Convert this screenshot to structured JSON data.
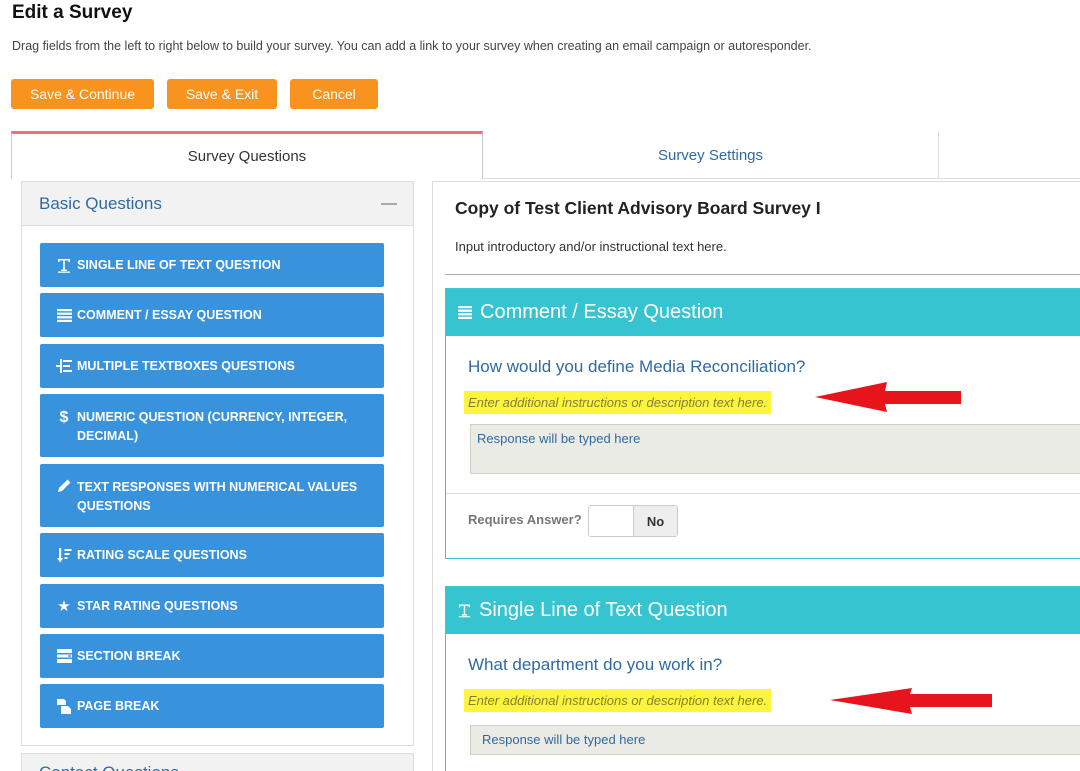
{
  "page": {
    "title": "Edit a Survey",
    "description": "Drag fields from the left to right below to build your survey. You can add a link to your survey when creating an email campaign or autoresponder."
  },
  "buttons": {
    "save_continue": "Save & Continue",
    "save_exit": "Save & Exit",
    "cancel": "Cancel"
  },
  "tabs": [
    {
      "label": "Survey Questions",
      "active": true
    },
    {
      "label": "Survey Settings",
      "active": false
    }
  ],
  "sidebar": {
    "section_title": "Basic Questions",
    "items": [
      {
        "label": "Single Line of Text Question",
        "icon": "text-icon"
      },
      {
        "label": "Comment / Essay Question",
        "icon": "lines-icon"
      },
      {
        "label": "Multiple Textboxes Questions",
        "icon": "textboxes-icon"
      },
      {
        "label": "Numeric Question (Currency, Integer, Decimal)",
        "icon": "dollar-icon"
      },
      {
        "label": "Text Responses with Numerical Values Questions",
        "icon": "pencil-icon"
      },
      {
        "label": "Rating Scale Questions",
        "icon": "sort-icon"
      },
      {
        "label": "Star Rating Questions",
        "icon": "star-icon"
      },
      {
        "label": "Section Break",
        "icon": "section-icon"
      },
      {
        "label": "Page Break",
        "icon": "page-break-icon"
      }
    ],
    "next_section_title": "Contact Questions"
  },
  "survey": {
    "title": "Copy of Test Client Advisory Board Survey I",
    "intro": "Input introductory and/or instructional text here.",
    "cards": [
      {
        "type_label": "Comment / Essay Question",
        "question": "How would you define Media Reconciliation?",
        "instructions": "Enter additional instructions or description text here.",
        "response_placeholder": "Response will be typed here",
        "requires_label": "Requires Answer?",
        "requires_value": "No"
      },
      {
        "type_label": "Single Line of Text Question",
        "question": "What department do you work in?",
        "instructions": "Enter additional instructions or description text here.",
        "response_placeholder": "Response will be typed here"
      }
    ]
  },
  "colors": {
    "accent_orange": "#f7931e",
    "question_blue": "#3893dc",
    "card_teal": "#36c5d0",
    "highlight_yellow": "#fbf53b",
    "annotation_red": "#e8141b"
  }
}
